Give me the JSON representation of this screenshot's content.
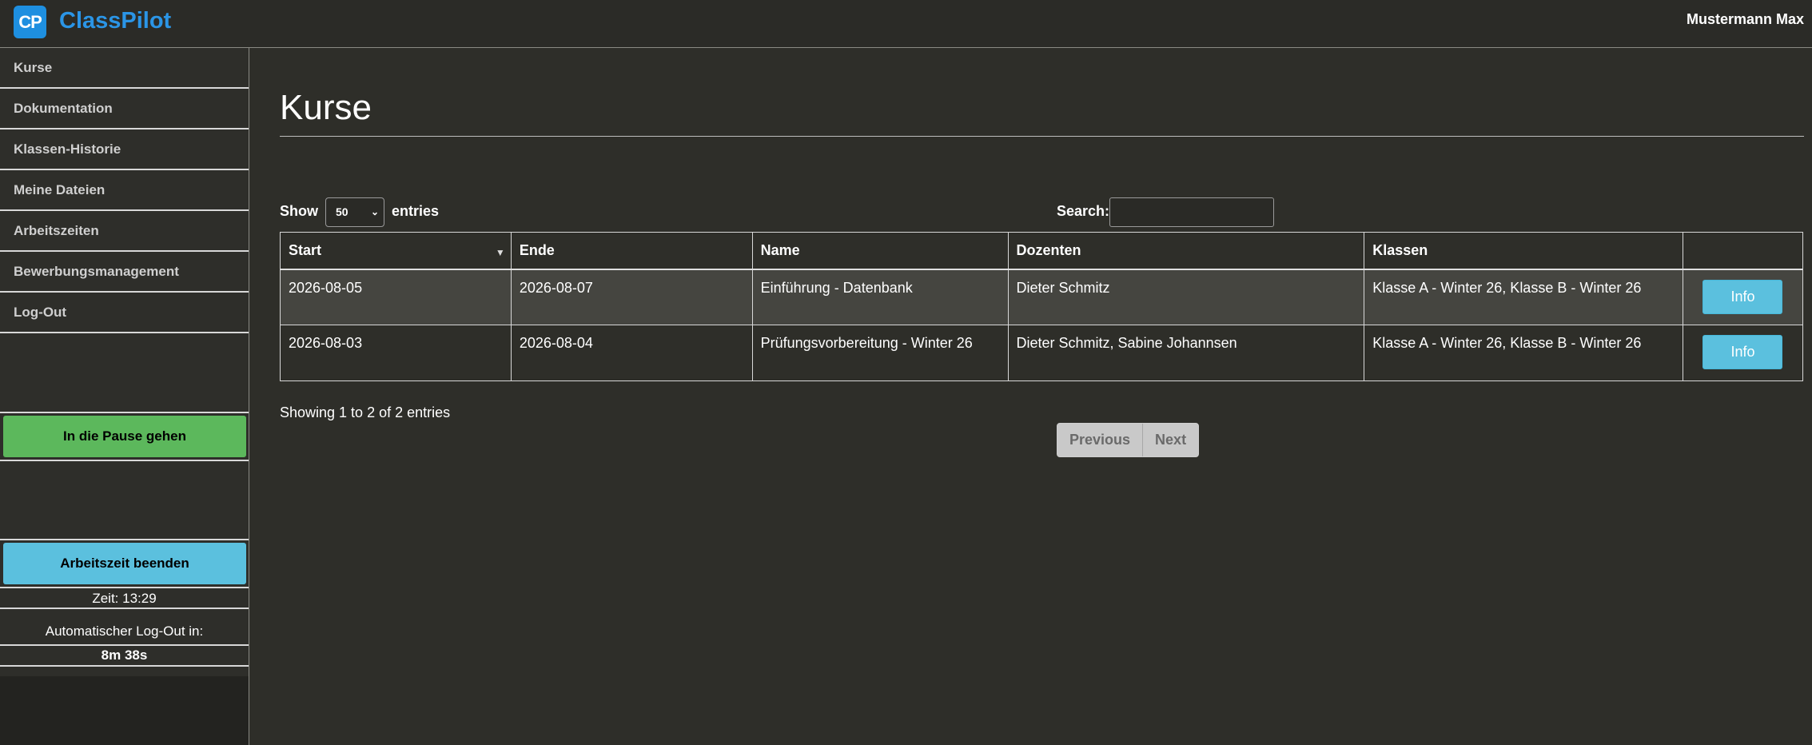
{
  "app": {
    "logo_badge": "CP",
    "name": "ClassPilot",
    "user": "Mustermann Max"
  },
  "sidebar": {
    "items": [
      {
        "label": "Kurse"
      },
      {
        "label": "Dokumentation"
      },
      {
        "label": "Klassen-Historie"
      },
      {
        "label": "Meine Dateien"
      },
      {
        "label": "Arbeitszeiten"
      },
      {
        "label": "Bewerbungsmanagement"
      },
      {
        "label": "Log-Out"
      }
    ],
    "pause_button": "In die Pause gehen",
    "end_work_button": "Arbeitszeit beenden",
    "time_text": "Zeit: 13:29",
    "autologout_label": "Automatischer Log-Out in:",
    "autologout_countdown": "8m 38s"
  },
  "main": {
    "title": "Kurse",
    "show_label": "Show",
    "entries_label": "entries",
    "page_length": "50",
    "search_label": "Search:",
    "search_value": "",
    "columns": [
      "Start",
      "Ende",
      "Name",
      "Dozenten",
      "Klassen",
      ""
    ],
    "rows": [
      {
        "start": "2026-08-05",
        "ende": "2026-08-07",
        "name": "Einführung - Datenbank",
        "dozenten": "Dieter Schmitz",
        "klassen": "Klasse A - Winter 26, Klasse B - Winter 26",
        "action": "Info"
      },
      {
        "start": "2026-08-03",
        "ende": "2026-08-04",
        "name": "Prüfungsvorbereitung - Winter 26",
        "dozenten": "Dieter Schmitz, Sabine Johannsen",
        "klassen": "Klasse A - Winter 26, Klasse B - Winter 26",
        "action": "Info"
      }
    ],
    "showing_text": "Showing 1 to 2 of 2 entries",
    "prev_label": "Previous",
    "next_label": "Next"
  },
  "colors": {
    "brand": "#2b95e6",
    "pause": "#5cb85c",
    "info": "#5bc0de",
    "background": "#2e2e29"
  },
  "icons": {
    "logo": "cp-logo-icon",
    "sort": "sort-desc-icon",
    "select": "chevron-down-icon"
  }
}
